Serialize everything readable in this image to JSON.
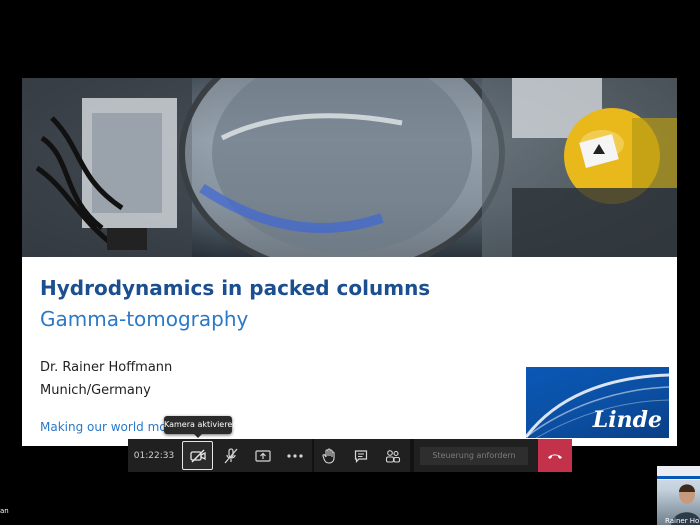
{
  "slide": {
    "title": "Hydrodynamics in packed columns",
    "subtitle": "Gamma-tomography",
    "author": "Dr. Rainer Hoffmann",
    "location": "Munich/Germany",
    "tagline": "Making our world more p",
    "logo_text": "Linde"
  },
  "tooltip": {
    "text": "Kamera aktivieren"
  },
  "callbar": {
    "timer": "01:22:33",
    "request_control_label": "Steuerung anfordern"
  },
  "participants": {
    "left_name": "an",
    "self_name": "Rainer Ho"
  },
  "colors": {
    "title": "#1b4f8f",
    "accent": "#2a79c8",
    "hangup": "#c4314b",
    "callbar": "#202020",
    "logo_blue": "#0a58b5"
  }
}
